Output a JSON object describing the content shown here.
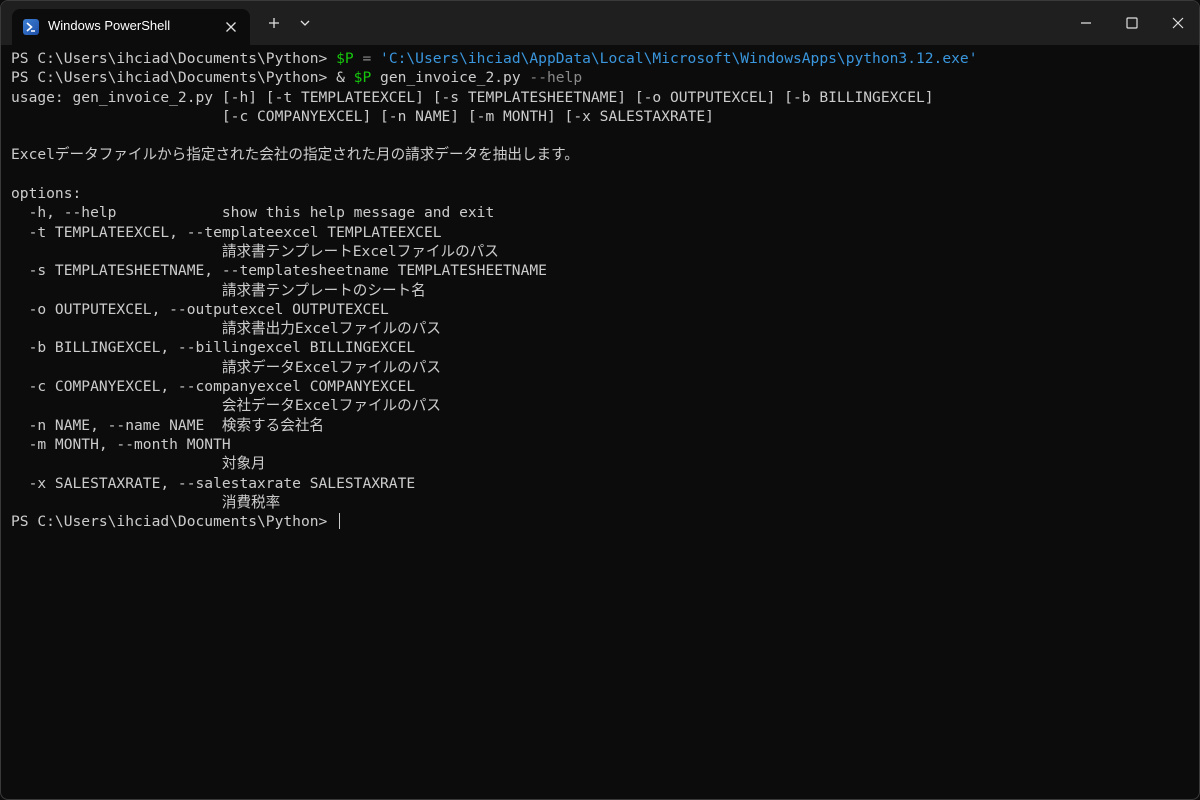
{
  "window": {
    "tab_title": "Windows PowerShell"
  },
  "terminal": {
    "cmd1": {
      "prompt": "PS C:\\Users\\ihciad\\Documents\\Python> ",
      "var": "$P",
      "op": " = ",
      "str": "'C:\\Users\\ihciad\\AppData\\Local\\Microsoft\\WindowsApps\\python3.12.exe'"
    },
    "cmd2": {
      "prompt": "PS C:\\Users\\ihciad\\Documents\\Python> ",
      "amp": "& ",
      "var": "$P",
      "args": " gen_invoice_2.py ",
      "flag": "--help"
    },
    "output": [
      "usage: gen_invoice_2.py [-h] [-t TEMPLATEEXCEL] [-s TEMPLATESHEETNAME] [-o OUTPUTEXCEL] [-b BILLINGEXCEL]",
      "                        [-c COMPANYEXCEL] [-n NAME] [-m MONTH] [-x SALESTAXRATE]",
      "",
      "Excelデータファイルから指定された会社の指定された月の請求データを抽出します。",
      "",
      "options:",
      "  -h, --help            show this help message and exit",
      "  -t TEMPLATEEXCEL, --templateexcel TEMPLATEEXCEL",
      "                        請求書テンプレートExcelファイルのパス",
      "  -s TEMPLATESHEETNAME, --templatesheetname TEMPLATESHEETNAME",
      "                        請求書テンプレートのシート名",
      "  -o OUTPUTEXCEL, --outputexcel OUTPUTEXCEL",
      "                        請求書出力Excelファイルのパス",
      "  -b BILLINGEXCEL, --billingexcel BILLINGEXCEL",
      "                        請求データExcelファイルのパス",
      "  -c COMPANYEXCEL, --companyexcel COMPANYEXCEL",
      "                        会社データExcelファイルのパス",
      "  -n NAME, --name NAME  検索する会社名",
      "  -m MONTH, --month MONTH",
      "                        対象月",
      "  -x SALESTAXRATE, --salestaxrate SALESTAXRATE",
      "                        消費税率"
    ],
    "final_prompt": "PS C:\\Users\\ihciad\\Documents\\Python> "
  }
}
